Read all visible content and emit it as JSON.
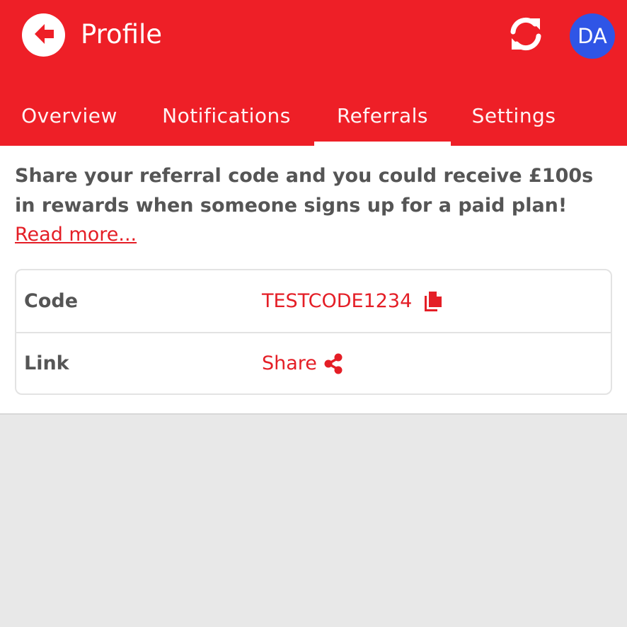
{
  "header": {
    "title": "Profile",
    "avatar_initials": "DA"
  },
  "tabs": [
    {
      "label": "Overview",
      "active": false
    },
    {
      "label": "Notifications",
      "active": false
    },
    {
      "label": "Referrals",
      "active": true
    },
    {
      "label": "Settings",
      "active": false
    }
  ],
  "referrals": {
    "intro": "Share your referral code and you could receive £100s in rewards when someone signs up for a paid plan!",
    "read_more": "Read more...",
    "rows": [
      {
        "label": "Code",
        "value": "TESTCODE1234",
        "icon": "copy-icon"
      },
      {
        "label": "Link",
        "value": "Share",
        "icon": "share-icon"
      }
    ]
  },
  "colors": {
    "brand": "#ee1f27",
    "accent_text": "#e41e26",
    "avatar": "#2f55e6",
    "body_text": "#555555",
    "background": "#e8e8e8"
  },
  "icons": {
    "back": "arrow-left-circle-icon",
    "refresh": "refresh-icon",
    "copy": "copy-icon",
    "share": "share-icon"
  }
}
